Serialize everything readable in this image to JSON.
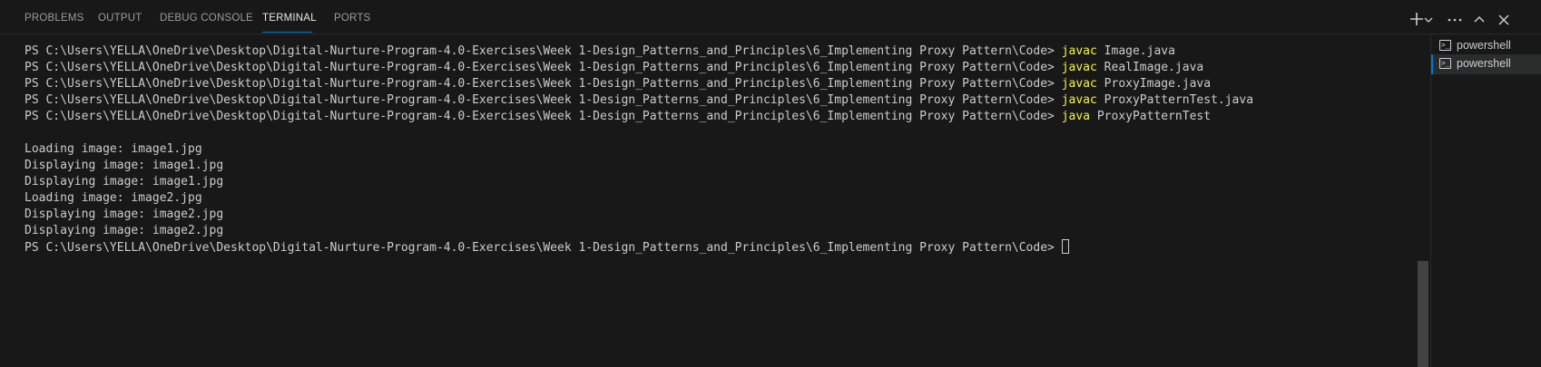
{
  "panel": {
    "tabs": [
      {
        "label": "PROBLEMS"
      },
      {
        "label": "OUTPUT"
      },
      {
        "label": "DEBUG CONSOLE"
      },
      {
        "label": "TERMINAL"
      },
      {
        "label": "PORTS"
      }
    ],
    "active_tab": "TERMINAL",
    "actions": {
      "new_terminal_icon": "plus-icon",
      "dropdown_icon": "chevron-down-icon",
      "more_icon": "ellipsis-icon",
      "maximize_icon": "chevron-up-icon"
    }
  },
  "terminal": {
    "lines": [
      {
        "prompt": "PS C:\\Users\\YELLA\\OneDrive\\Desktop\\Digital-Nurture-Program-4.0-Exercises\\Week 1-Design_Patterns_and_Principles\\6_Implementing Proxy Pattern\\Code> ",
        "cmd": "javac",
        "args": " Image.java"
      },
      {
        "prompt": "PS C:\\Users\\YELLA\\OneDrive\\Desktop\\Digital-Nurture-Program-4.0-Exercises\\Week 1-Design_Patterns_and_Principles\\6_Implementing Proxy Pattern\\Code> ",
        "cmd": "javac",
        "args": " RealImage.java"
      },
      {
        "prompt": "PS C:\\Users\\YELLA\\OneDrive\\Desktop\\Digital-Nurture-Program-4.0-Exercises\\Week 1-Design_Patterns_and_Principles\\6_Implementing Proxy Pattern\\Code> ",
        "cmd": "javac",
        "args": " ProxyImage.java"
      },
      {
        "prompt": "PS C:\\Users\\YELLA\\OneDrive\\Desktop\\Digital-Nurture-Program-4.0-Exercises\\Week 1-Design_Patterns_and_Principles\\6_Implementing Proxy Pattern\\Code> ",
        "cmd": "javac",
        "args": " ProxyPatternTest.java"
      },
      {
        "prompt": "PS C:\\Users\\YELLA\\OneDrive\\Desktop\\Digital-Nurture-Program-4.0-Exercises\\Week 1-Design_Patterns_and_Principles\\6_Implementing Proxy Pattern\\Code> ",
        "cmd": "java",
        "args": " ProxyPatternTest"
      }
    ],
    "output": [
      "Loading image: image1.jpg",
      "Displaying image: image1.jpg",
      "Displaying image: image1.jpg",
      "Loading image: image2.jpg",
      "Displaying image: image2.jpg",
      "Displaying image: image2.jpg"
    ],
    "final_prompt": "PS C:\\Users\\YELLA\\OneDrive\\Desktop\\Digital-Nurture-Program-4.0-Exercises\\Week 1-Design_Patterns_and_Principles\\6_Implementing Proxy Pattern\\Code> "
  },
  "sidebar": {
    "shells": [
      {
        "label": "powershell",
        "icon": "terminal-powershell-icon"
      },
      {
        "label": "powershell",
        "icon": "terminal-powershell-icon"
      }
    ]
  },
  "colors": {
    "background": "#181818",
    "text": "#cccccc",
    "command": "#f5f543",
    "accent": "#0078d4"
  }
}
